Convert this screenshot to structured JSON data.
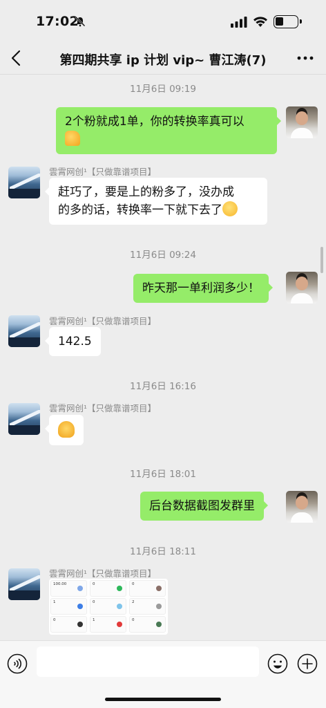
{
  "status_bar": {
    "time": "17:02"
  },
  "header": {
    "title": "第四期共享 ip 计划 vip~ 曹江涛(7)"
  },
  "sender_name": "雲霄网创¹【只做靠谱项目】",
  "messages": [
    {
      "type": "timestamp",
      "text": "11月6日 09:19"
    },
    {
      "type": "sent",
      "text": "2个粉就成1单，你的转换率真可以",
      "emoji": "thumbs-up-emoji"
    },
    {
      "type": "received",
      "line1": "赶巧了，要是上的粉多了，没办成",
      "line2": "的多的话，转换率一下就下去了",
      "emoji": "laughing-emoji"
    },
    {
      "type": "timestamp",
      "text": "11月6日 09:24"
    },
    {
      "type": "sent",
      "text": "昨天那一单利润多少！"
    },
    {
      "type": "received",
      "text": "142.5"
    },
    {
      "type": "timestamp",
      "text": "11月6日 16:16"
    },
    {
      "type": "received",
      "emoji": "ok-hand-emoji"
    },
    {
      "type": "timestamp",
      "text": "11月6日 18:01"
    },
    {
      "type": "sent",
      "text": "后台数据截图发群里"
    },
    {
      "type": "timestamp",
      "text": "11月6日 18:11"
    },
    {
      "type": "received-image",
      "cells": [
        {
          "label": "",
          "value": "100.00"
        },
        {
          "label": "",
          "value": "0"
        },
        {
          "label": "",
          "value": "0"
        },
        {
          "label": "",
          "value": "1"
        },
        {
          "label": "",
          "value": "0"
        },
        {
          "label": "",
          "value": "2"
        },
        {
          "label": "",
          "value": "0"
        },
        {
          "label": "",
          "value": "1"
        },
        {
          "label": "",
          "value": "0"
        }
      ]
    }
  ],
  "input_bar": {
    "placeholder": ""
  },
  "colors": {
    "sent_bubble": "#95ec69",
    "received_bubble": "#ffffff",
    "background": "#ededed"
  }
}
